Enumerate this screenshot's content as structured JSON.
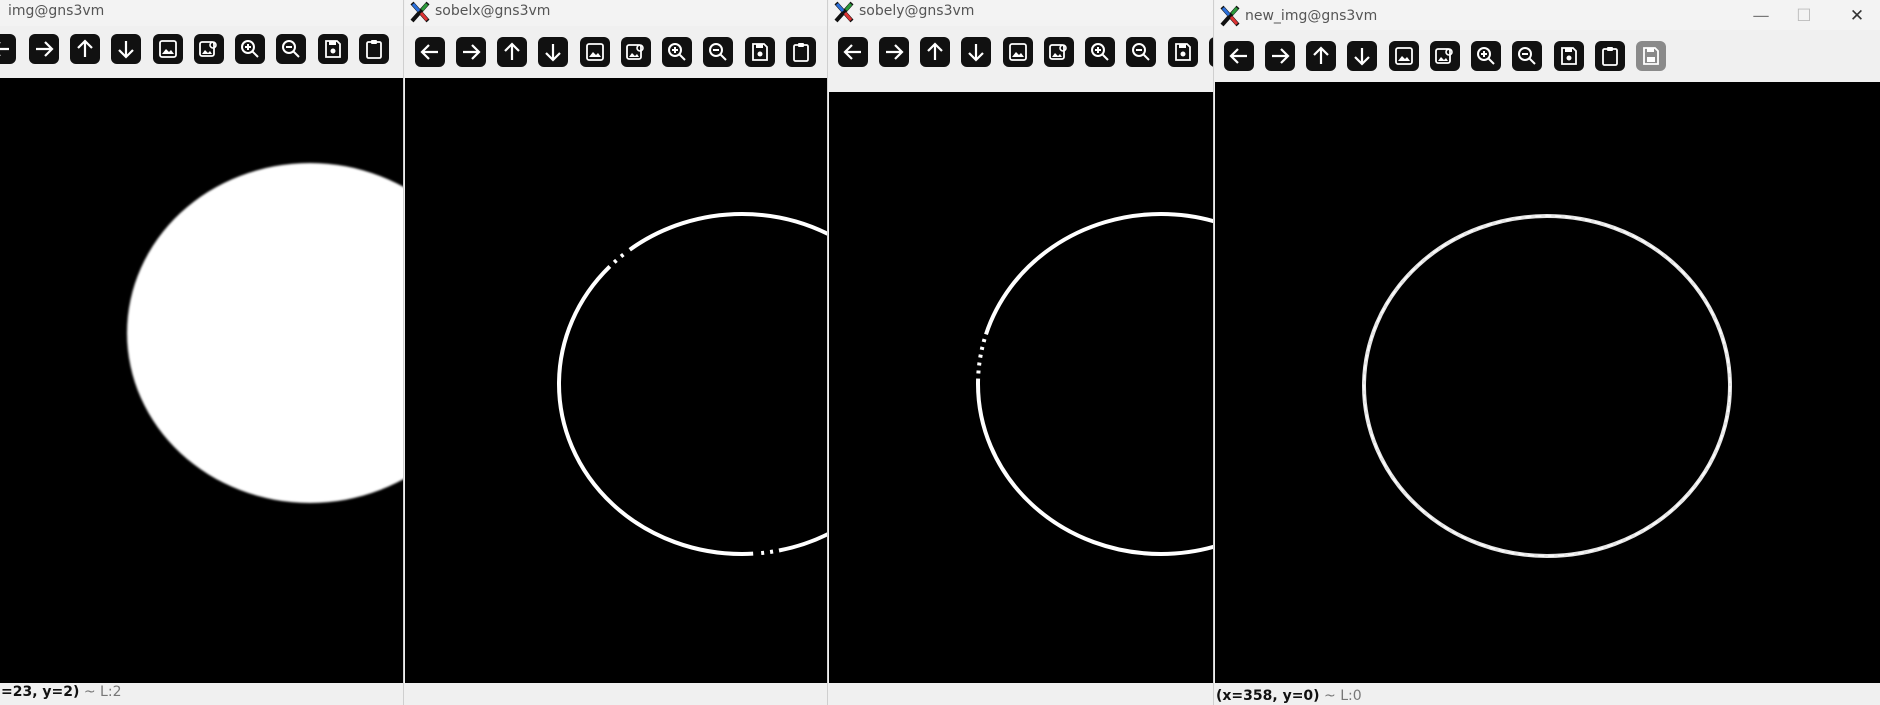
{
  "windows": [
    {
      "title": "img@gns3vm",
      "status": {
        "coords": "=23, y=2)",
        "separator": " ~ ",
        "level": "L:2"
      }
    },
    {
      "title": "sobelx@gns3vm",
      "status": {
        "coords": "",
        "separator": "",
        "level": ""
      }
    },
    {
      "title": "sobely@gns3vm",
      "status": {
        "coords": "",
        "separator": "",
        "level": ""
      }
    },
    {
      "title": "new_img@gns3vm",
      "status": {
        "coords": "(x=358, y=0)",
        "separator": " ~ ",
        "level": "L:0"
      }
    }
  ],
  "toolbar_icons": [
    "arrow-left-icon",
    "arrow-right-icon",
    "arrow-up-icon",
    "arrow-down-icon",
    "image-icon",
    "image-search-icon",
    "zoom-in-icon",
    "zoom-out-icon",
    "save-icon",
    "clipboard-icon",
    "save-disabled-icon"
  ],
  "window_controls": {
    "minimize": "—",
    "maximize": "☐",
    "close": "✕"
  },
  "colors": {
    "canvas": "#000000",
    "figure": "#ffffff",
    "toolbar_button": "#111111",
    "disabled_button": "#8a8a8a"
  }
}
